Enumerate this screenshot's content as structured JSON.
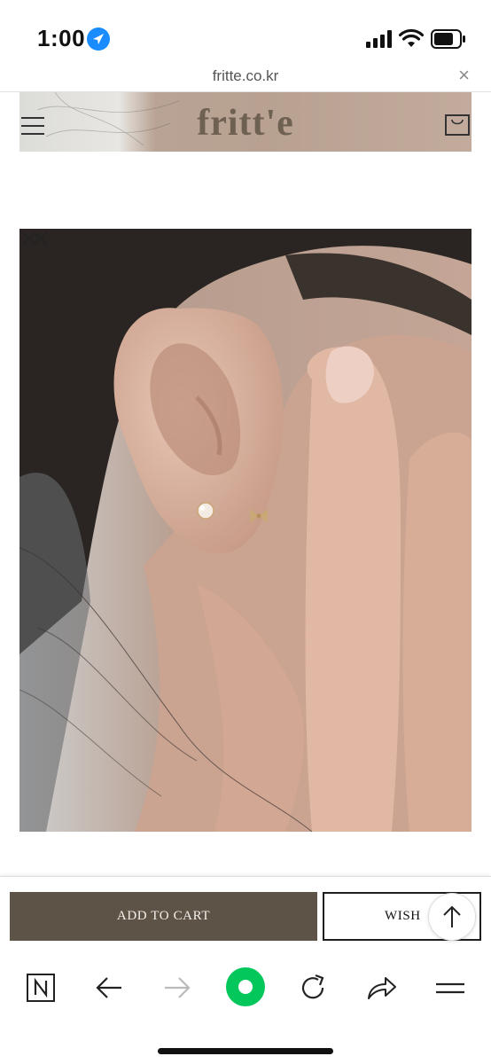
{
  "status_bar": {
    "time": "1:00",
    "icons": [
      "location-arrow-icon",
      "cellular-signal-icon",
      "wifi-icon",
      "battery-icon"
    ]
  },
  "url_bar": {
    "url": "fritte.co.kr",
    "close_label": "×"
  },
  "site_header": {
    "logo": "fritt'e",
    "icons": [
      "hamburger-menu-icon",
      "shopping-bag-icon"
    ]
  },
  "product_image": {
    "description_icons": [
      "chevron-up-icon",
      "chevron-down-icon"
    ]
  },
  "actions": {
    "add_to_cart": "ADD TO CART",
    "wish": "WISH",
    "scroll_top_icon": "arrow-up-icon"
  },
  "browser_toolbar": {
    "items": [
      "naver-n-icon",
      "back-arrow-icon",
      "forward-arrow-icon",
      "green-dot-icon",
      "reload-icon",
      "share-icon",
      "menu-icon"
    ]
  },
  "colors": {
    "cart_button": "#5d5346",
    "logo": "#6f6152",
    "location": "#1a8cff",
    "green_dot": "#03c75a"
  }
}
